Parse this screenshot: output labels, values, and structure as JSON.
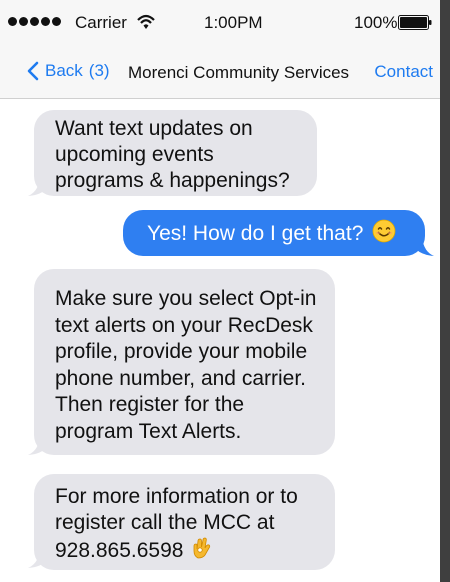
{
  "status_bar": {
    "carrier": "Carrier",
    "time": "1:00PM",
    "battery": "100%"
  },
  "nav": {
    "back_label": "Back",
    "back_count": "(3)",
    "title": "Morenci Community Services",
    "contact_label": "Contact"
  },
  "messages": [
    {
      "direction": "incoming",
      "lines": [
        "Want text updates on",
        "upcoming events",
        "programs & happenings?"
      ]
    },
    {
      "direction": "outgoing",
      "text": "Yes! How do I get that?",
      "emoji": "smiling-face-icon"
    },
    {
      "direction": "incoming",
      "lines": [
        "Make sure you select Opt-in",
        "text alerts on your RecDesk",
        "profile, provide your mobile",
        "phone number, and carrier.",
        "Then register for the",
        "program Text Alerts."
      ]
    },
    {
      "direction": "incoming",
      "lines": [
        "For more information or to",
        "register call the MCC at",
        "928.865.6598"
      ],
      "emoji": "ok-hand-icon"
    }
  ],
  "colors": {
    "accent_blue": "#1e7bf0",
    "outgoing_bubble": "#2f7ff1",
    "incoming_bubble": "#e5e5ea",
    "bar_background": "#f7f7f7"
  }
}
